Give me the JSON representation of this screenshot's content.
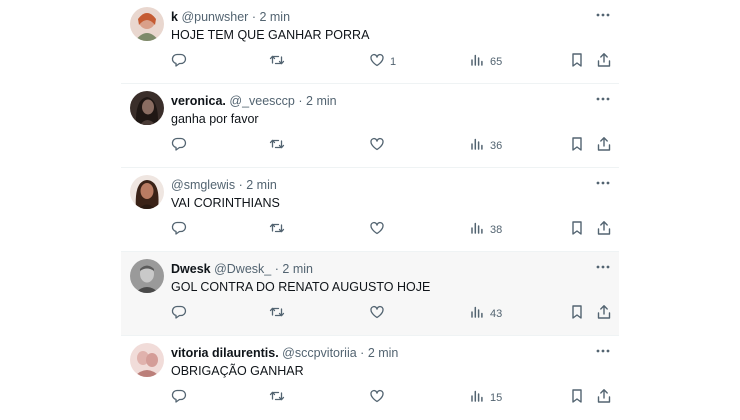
{
  "tweets": [
    {
      "name": "k",
      "handle": "@punwsher",
      "time": "2 min",
      "text": "HOJE TEM QUE GANHAR PORRA",
      "likes": "1",
      "views": "65",
      "avatar_color": "#d9a08a",
      "avatar_hair": "#c55b32"
    },
    {
      "name": "veronica.",
      "handle": "@_veesccp",
      "time": "2 min",
      "text": "ganha por favor",
      "likes": "",
      "views": "36",
      "avatar_color": "#6a5a55",
      "avatar_hair": "#2b211d"
    },
    {
      "name": "",
      "handle": "@smglewis",
      "time": "2 min",
      "text": "VAI CORINTHIANS",
      "likes": "",
      "views": "38",
      "avatar_color": "#a56e55",
      "avatar_hair": "#3a2217"
    },
    {
      "name": "Dwesk",
      "handle": "@Dwesk_",
      "time": "2 min",
      "text": "GOL CONTRA  DO RENATO AUGUSTO HOJE",
      "likes": "",
      "views": "43",
      "avatar_color": "#b9b9b9",
      "avatar_hair": "#5b5b5b"
    },
    {
      "name": "vitoria dilaurentis.",
      "handle": "@sccpvitoriia",
      "time": "2 min",
      "text": "OBRIGAÇÃO GANHAR",
      "likes": "",
      "views": "15",
      "avatar_color": "#e0b2ad",
      "avatar_hair": "#bb7f7a"
    }
  ],
  "separator": "·",
  "colors": {
    "text": "#0f1419",
    "muted": "#536471",
    "hover_bg": "#f7f7f7",
    "border": "#eff3f4"
  },
  "icons": [
    "more-icon",
    "reply-icon",
    "retweet-icon",
    "like-icon",
    "views-icon",
    "bookmark-icon",
    "share-icon"
  ]
}
